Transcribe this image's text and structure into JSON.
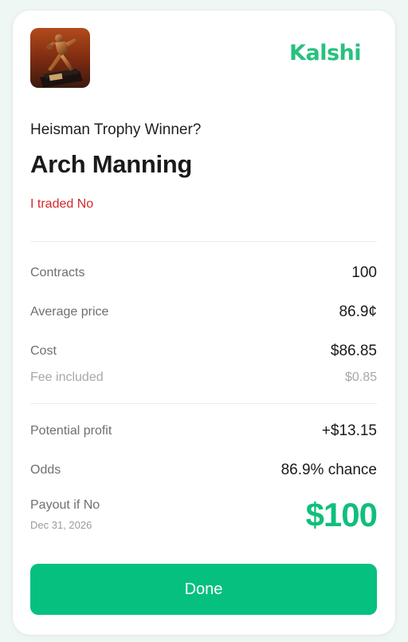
{
  "brand": {
    "name": "Kalshi",
    "color": "#27c17f"
  },
  "market": {
    "question": "Heisman Trophy Winner?",
    "outcome": "Arch Manning",
    "side_text": "I traded No",
    "image_icon": "heisman-trophy-image"
  },
  "details": {
    "contracts": {
      "label": "Contracts",
      "value": "100"
    },
    "average_price": {
      "label": "Average price",
      "value": "86.9¢"
    },
    "cost": {
      "label": "Cost",
      "value": "$86.85"
    },
    "fee": {
      "label": "Fee included",
      "value": "$0.85"
    }
  },
  "summary": {
    "potential_profit": {
      "label": "Potential profit",
      "value": "+$13.15"
    },
    "odds": {
      "label": "Odds",
      "value": "86.9% chance"
    },
    "payout": {
      "label": "Payout if No",
      "date": "Dec 31, 2026",
      "amount": "$100"
    }
  },
  "actions": {
    "done_label": "Done"
  },
  "colors": {
    "accent": "#06c07f",
    "negative": "#d6262a"
  }
}
